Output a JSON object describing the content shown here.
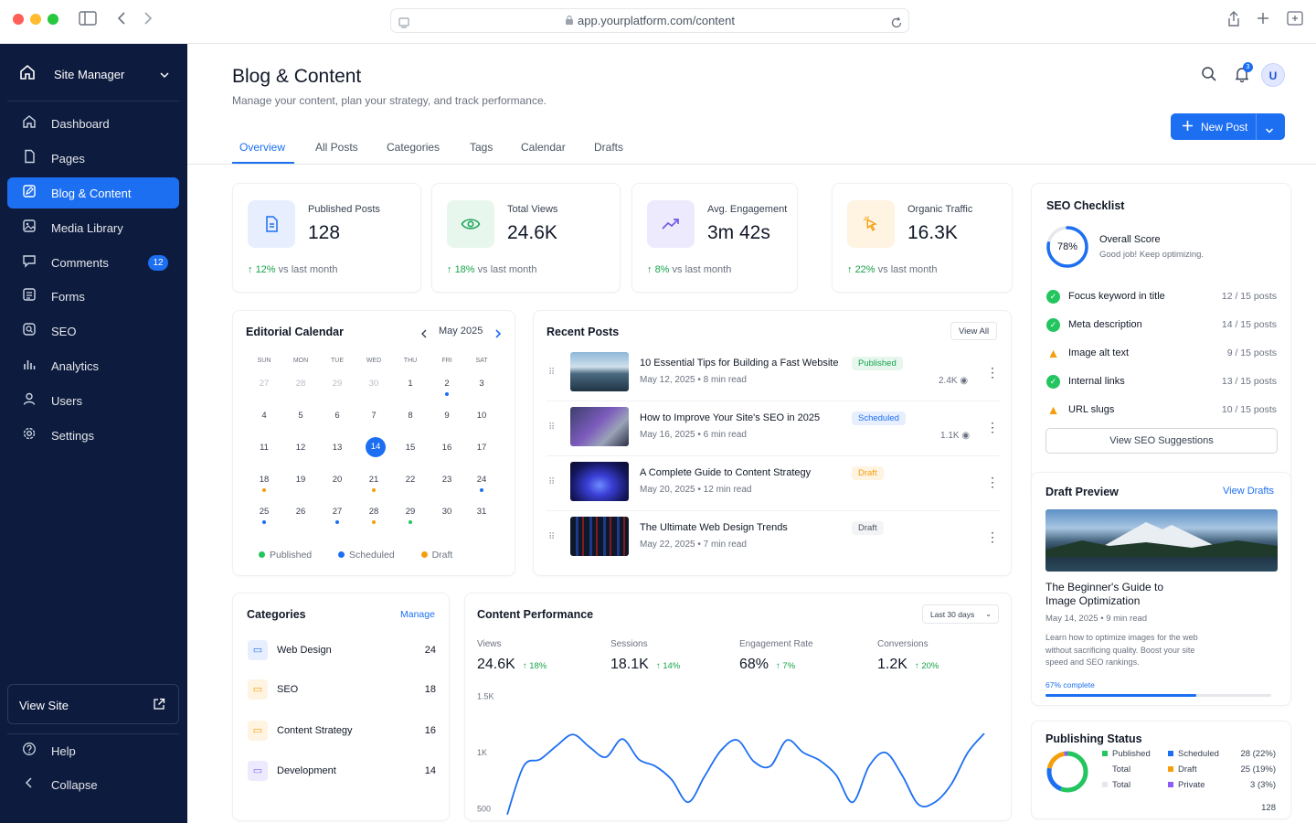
{
  "browser": {
    "url": "app.yourplatform.com/content"
  },
  "sidebar": {
    "workspace": "Site Manager",
    "items": [
      {
        "label": "Dashboard",
        "icon": "home-icon"
      },
      {
        "label": "Pages",
        "icon": "file-icon"
      },
      {
        "label": "Blog & Content",
        "icon": "edit-icon",
        "active": true
      },
      {
        "label": "Media Library",
        "icon": "image-icon"
      },
      {
        "label": "Comments",
        "icon": "comment-icon",
        "badge": "12"
      },
      {
        "label": "Forms",
        "icon": "form-icon"
      },
      {
        "label": "SEO",
        "icon": "search-icon"
      },
      {
        "label": "Analytics",
        "icon": "bar-chart-icon"
      },
      {
        "label": "Users",
        "icon": "user-icon"
      },
      {
        "label": "Settings",
        "icon": "gear-icon"
      }
    ],
    "view_site": "View Site",
    "help": "Help",
    "collapse": "Collapse"
  },
  "header": {
    "title": "Blog & Content",
    "subtitle": "Manage your content, plan your strategy, and track performance.",
    "notifications": "3",
    "avatar": "U",
    "new_post": "New Post",
    "tabs": [
      "Overview",
      "All Posts",
      "Categories",
      "Tags",
      "Calendar",
      "Drafts"
    ]
  },
  "stats": [
    {
      "label": "Published Posts",
      "value": "128",
      "change": "12%",
      "suffix": "vs last month",
      "icon": "document-icon"
    },
    {
      "label": "Total Views",
      "value": "24.6K",
      "change": "18%",
      "suffix": "vs last month",
      "icon": "eye-icon"
    },
    {
      "label": "Avg. Engagement",
      "value": "3m 42s",
      "change": "8%",
      "suffix": "vs last month",
      "icon": "trend-icon"
    },
    {
      "label": "Organic Traffic",
      "value": "16.3K",
      "change": "22%",
      "suffix": "vs last month",
      "icon": "cursor-icon"
    }
  ],
  "calendar": {
    "title": "Editorial Calendar",
    "month": "May 2025",
    "weekdays": [
      "SUN",
      "MON",
      "TUE",
      "WED",
      "THU",
      "FRI",
      "SAT"
    ],
    "weeks": [
      [
        "27",
        "28",
        "29",
        "30",
        "1",
        "2",
        "3"
      ],
      [
        "4",
        "5",
        "6",
        "7",
        "8",
        "9",
        "10"
      ],
      [
        "11",
        "12",
        "13",
        "14",
        "15",
        "16",
        "17"
      ],
      [
        "18",
        "19",
        "20",
        "21",
        "22",
        "23",
        "24"
      ],
      [
        "25",
        "26",
        "27",
        "28",
        "29",
        "30",
        "31"
      ]
    ],
    "legend": {
      "published": "Published",
      "scheduled": "Scheduled",
      "draft": "Draft"
    }
  },
  "recent_posts": {
    "title": "Recent Posts",
    "view_all": "View All",
    "items": [
      {
        "title": "10 Essential Tips for Building a Fast Website",
        "date": "May 12, 2025",
        "read": "8 min read",
        "status": "Published",
        "views": "2.4K"
      },
      {
        "title": "How to Improve Your Site's SEO in 2025",
        "date": "May 16, 2025",
        "read": "6 min read",
        "status": "Scheduled",
        "views": "1.1K"
      },
      {
        "title": "A Complete Guide to Content Strategy",
        "date": "May 20, 2025",
        "read": "12 min read",
        "status": "Draft",
        "views": ""
      },
      {
        "title": "The Ultimate Web Design Trends",
        "date": "May 22, 2025",
        "read": "7 min read",
        "status": "Draft",
        "views": ""
      }
    ]
  },
  "seo": {
    "title": "SEO Checklist",
    "score": "78%",
    "score_value": 78,
    "overall": "Overall Score",
    "overall_sub": "Good job! Keep optimizing.",
    "items": [
      {
        "label": "Focus keyword in title",
        "count": "12 / 15 posts",
        "ok": true
      },
      {
        "label": "Meta description",
        "count": "14 / 15 posts",
        "ok": true
      },
      {
        "label": "Image alt text",
        "count": "9 / 15 posts",
        "ok": false
      },
      {
        "label": "Internal links",
        "count": "13 / 15 posts",
        "ok": true
      },
      {
        "label": "URL slugs",
        "count": "10 / 15 posts",
        "ok": false
      }
    ],
    "button": "View SEO Suggestions"
  },
  "draft_preview": {
    "title": "Draft Preview",
    "view_drafts": "View Drafts",
    "post_title_1": "The Beginner's Guide to",
    "post_title_2": "Image Optimization",
    "date": "May 14, 2025",
    "read": "9 min read",
    "excerpt_1": "Learn how to optimize images for the web",
    "excerpt_2": "without sacrificing quality. Boost your site",
    "excerpt_3": "speed and SEO rankings.",
    "progress_label": "67% complete",
    "progress": 67
  },
  "categories": {
    "title": "Categories",
    "manage": "Manage",
    "items": [
      {
        "name": "Web Design",
        "count": "24",
        "color": "#1d6ff2"
      },
      {
        "name": "SEO",
        "count": "18",
        "color": "#f59e0b"
      },
      {
        "name": "Content Strategy",
        "count": "16",
        "color": "#f59e0b"
      },
      {
        "name": "Development",
        "count": "14",
        "color": "#7c6cf0"
      }
    ]
  },
  "performance": {
    "title": "Content Performance",
    "range": "Last 30 days",
    "metrics": [
      {
        "label": "Views",
        "value": "24.6K",
        "change": "18%"
      },
      {
        "label": "Sessions",
        "value": "18.1K",
        "change": "14%"
      },
      {
        "label": "Engagement Rate",
        "value": "68%",
        "change": "7%"
      },
      {
        "label": "Conversions",
        "value": "1.2K",
        "change": "20%"
      }
    ],
    "y_ticks": [
      "1.5K",
      "1K",
      "500"
    ]
  },
  "chart_data": {
    "type": "line",
    "series": [
      {
        "values": [
          450,
          880,
          940,
          1060,
          1160,
          1050,
          960,
          1120,
          940,
          880,
          760,
          560,
          790,
          1020,
          1110,
          920,
          880,
          1110,
          1000,
          930,
          800,
          560,
          880,
          1000,
          800,
          540,
          560,
          720,
          1000,
          1170
        ]
      }
    ],
    "ylim": [
      400,
      1600
    ],
    "y_ticks": [
      "1.5K",
      "1K",
      "500"
    ],
    "grid": false
  },
  "publishing": {
    "title": "Publishing Status",
    "left": [
      {
        "label": "Published"
      },
      {
        "label": "Total"
      },
      {
        "label": "Total"
      }
    ],
    "right": [
      {
        "label": "Scheduled",
        "value": "28 (22%)"
      },
      {
        "label": "Draft",
        "value": "25 (19%)"
      },
      {
        "label": "Private",
        "value": "3 (3%)"
      }
    ],
    "total": "128"
  },
  "colors": {
    "accent": "#1d6ff2",
    "sidebar": "#0d1b3e",
    "published": "#22c55e",
    "draft": "#f59e0b",
    "private": "#8b5cf6"
  }
}
